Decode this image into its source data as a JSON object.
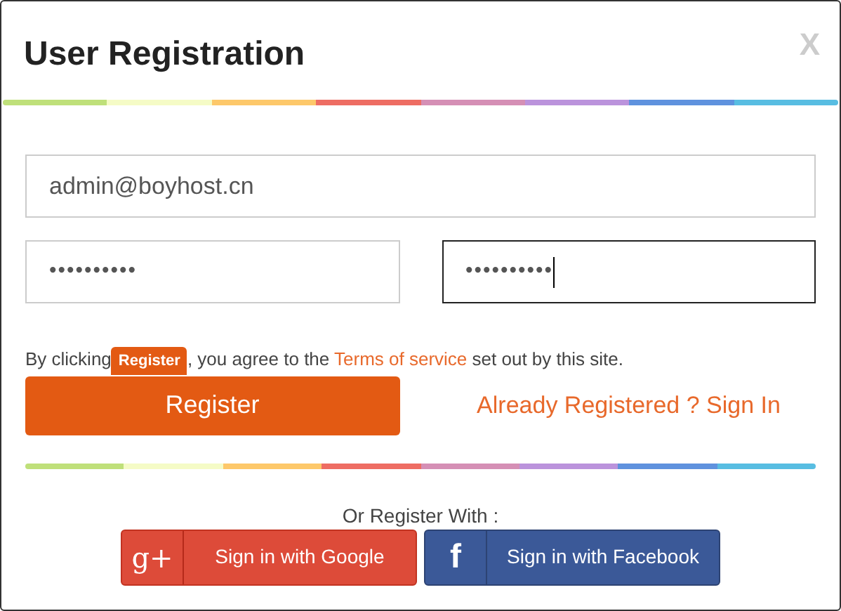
{
  "dialog": {
    "title": "User Registration",
    "close": "X"
  },
  "fields": [
    {
      "kind": "text",
      "value": "admin@boyhost.cn",
      "focused": false
    },
    {
      "kind": "password",
      "value": "••••••••••",
      "focused": false
    },
    {
      "kind": "password",
      "value": "••••••••••",
      "focused": true
    }
  ],
  "terms": {
    "before": "By clicking",
    "badge": "Register",
    "middle": ", you agree to the",
    "link": "Terms of service",
    "after": "set out by this site."
  },
  "register_button": "Register",
  "sign_in_link": "Already Registered ? Sign In",
  "social": {
    "heading": "Or Register With :",
    "buttons": [
      {
        "kind": "google",
        "icon": "g+",
        "label": "Sign in with Google"
      },
      {
        "kind": "facebook",
        "icon": "f",
        "label": "Sign in with Facebook"
      }
    ]
  }
}
